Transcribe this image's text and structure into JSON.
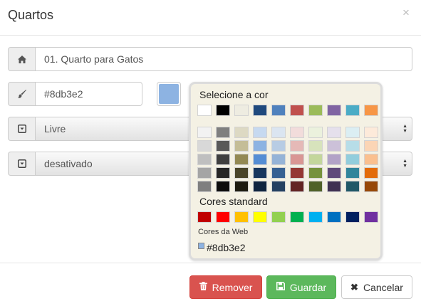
{
  "modal": {
    "title": "Quartos",
    "close_symbol": "×"
  },
  "fields": {
    "name": {
      "icon": "home-icon",
      "value": "01. Quarto para Gatos"
    },
    "color": {
      "icon": "paint-brush-icon",
      "value": "#8db3e2"
    },
    "status": {
      "icon": "caret-square-down-icon",
      "value": "Livre"
    },
    "active": {
      "icon": "caret-square-down-icon",
      "value": "desativado"
    }
  },
  "picker": {
    "title": "Selecione a cor",
    "standard_title": "Cores standard",
    "web_label": "Cores da Web",
    "current_value": "#8db3e2",
    "theme_row": [
      "#ffffff",
      "#000000",
      "#eeece1",
      "#1f497d",
      "#4f81bd",
      "#c0504d",
      "#9bbb59",
      "#8064a2",
      "#4bacc6",
      "#f79646"
    ],
    "shades": [
      [
        "#f2f2f2",
        "#7f7f7f",
        "#ddd9c3",
        "#c6d9f0",
        "#dbe5f1",
        "#f2dcdb",
        "#ebf1dd",
        "#e5e0ec",
        "#dbeef3",
        "#fdeada"
      ],
      [
        "#d8d8d8",
        "#595959",
        "#c4bd97",
        "#8db3e2",
        "#b8cce4",
        "#e5b9b7",
        "#d7e3bc",
        "#ccc1d9",
        "#b7dde8",
        "#fbd5b5"
      ],
      [
        "#bfbfbf",
        "#3f3f3f",
        "#938953",
        "#548dd4",
        "#95b3d7",
        "#d99694",
        "#c3d69b",
        "#b2a2c7",
        "#92cddc",
        "#fac08f"
      ],
      [
        "#a5a5a5",
        "#262626",
        "#494429",
        "#17365d",
        "#366092",
        "#953734",
        "#76923c",
        "#5f497a",
        "#31859b",
        "#e36c09"
      ],
      [
        "#7f7f7f",
        "#0c0c0c",
        "#1d1b10",
        "#0f243e",
        "#244061",
        "#632423",
        "#4f6128",
        "#3f3151",
        "#205867",
        "#974806"
      ]
    ],
    "standard": [
      "#c00000",
      "#ff0000",
      "#ffc000",
      "#ffff00",
      "#92d050",
      "#00b050",
      "#00b0f0",
      "#0070c0",
      "#002060",
      "#7030a0"
    ]
  },
  "buttons": {
    "remove": {
      "label": "Remover",
      "icon": "trash-icon",
      "color": "#d9534f"
    },
    "save": {
      "label": "Guardar",
      "icon": "save-icon",
      "color": "#5cb85c"
    },
    "cancel": {
      "label": "Cancelar",
      "icon": "close-icon"
    }
  }
}
